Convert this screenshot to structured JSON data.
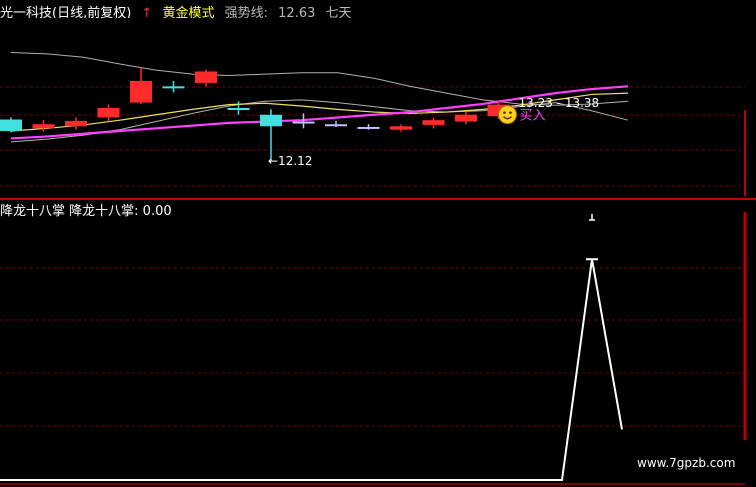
{
  "colors": {
    "background": "#000000",
    "grid": "#7a0000",
    "separator": "#c00000",
    "bull": "#ff2a2a",
    "bear": "#44e0e0",
    "ma_main": "#ff40ff",
    "ma_yellow": "#f0e060",
    "ma_grey": "#b0b0b0",
    "text_white": "#ffffff",
    "text_grey": "#b8b8b8",
    "text_yellow": "#ffff40"
  },
  "header": {
    "security": "光一科技(日线,前复权)",
    "arrow_icon": "↑",
    "indicator": "黄金模式",
    "strength_label": "强势线:",
    "strength_value": "12.63",
    "trailing_text": "七天"
  },
  "sub_header": {
    "name": "降龙十八掌",
    "value_label": "降龙十八掌: 0.00"
  },
  "annotations": {
    "low_price": "←12.12",
    "price_range": "13.23 - 13.38",
    "buy_signal": "买入"
  },
  "watermark": "www.7gpzb.com",
  "chart_data": [
    {
      "type": "candlestick",
      "panel": "main",
      "ylim": [
        11.6,
        14.2
      ],
      "candles": [
        {
          "o": 12.73,
          "c": 12.56,
          "h": 12.76,
          "l": 12.54
        },
        {
          "o": 12.6,
          "c": 12.66,
          "h": 12.72,
          "l": 12.55
        },
        {
          "o": 12.63,
          "c": 12.71,
          "h": 12.76,
          "l": 12.58
        },
        {
          "o": 12.76,
          "c": 12.9,
          "h": 12.95,
          "l": 12.7
        },
        {
          "o": 12.98,
          "c": 13.3,
          "h": 13.5,
          "l": 12.96
        },
        {
          "o": 13.22,
          "c": 13.22,
          "h": 13.3,
          "l": 13.13
        },
        {
          "o": 13.27,
          "c": 13.44,
          "h": 13.47,
          "l": 13.22
        },
        {
          "o": 12.9,
          "c": 12.9,
          "h": 13.0,
          "l": 12.8
        },
        {
          "o": 12.8,
          "c": 12.63,
          "h": 12.88,
          "l": 12.12
        },
        {
          "o": 12.7,
          "c": 12.7,
          "h": 12.82,
          "l": 12.6
        },
        {
          "o": 12.66,
          "c": 12.66,
          "h": 12.71,
          "l": 12.62
        },
        {
          "o": 12.62,
          "c": 12.62,
          "h": 12.66,
          "l": 12.58
        },
        {
          "o": 12.58,
          "c": 12.63,
          "h": 12.66,
          "l": 12.55
        },
        {
          "o": 12.65,
          "c": 12.72,
          "h": 12.76,
          "l": 12.6
        },
        {
          "o": 12.7,
          "c": 12.8,
          "h": 12.85,
          "l": 12.66
        },
        {
          "o": 12.78,
          "c": 12.95,
          "h": 13.0,
          "l": 12.74
        }
      ],
      "ma_main": [
        12.45,
        12.48,
        12.52,
        12.56,
        12.6,
        12.64,
        12.68,
        12.7,
        12.72,
        12.76,
        12.8,
        12.84,
        12.9,
        12.96,
        13.04,
        13.12,
        13.18,
        13.22
      ],
      "ma_yellow": [
        12.56,
        12.6,
        12.65,
        12.72,
        12.8,
        12.88,
        12.95,
        12.97,
        12.93,
        12.88,
        12.84,
        12.82,
        12.84,
        12.88,
        12.94,
        13.02,
        13.1,
        13.12
      ],
      "ma_grey_upper": [
        13.72,
        13.7,
        13.65,
        13.55,
        13.46,
        13.4,
        13.38,
        13.4,
        13.42,
        13.42,
        13.34,
        13.22,
        13.12,
        13.02,
        12.96,
        12.94,
        12.96,
        13.0
      ],
      "ma_grey_lower": [
        12.4,
        12.44,
        12.5,
        12.58,
        12.7,
        12.82,
        12.93,
        13.0,
        13.02,
        12.98,
        12.92,
        12.86,
        12.84,
        12.86,
        12.92,
        12.98,
        12.86,
        12.72
      ]
    },
    {
      "type": "line",
      "panel": "sub",
      "title": "降龙十八掌",
      "ylim": [
        0,
        100
      ],
      "x": [
        0,
        1,
        2,
        3,
        4,
        5,
        6,
        7,
        8,
        9,
        10,
        11,
        12,
        13,
        14,
        15,
        16,
        17
      ],
      "values": [
        0,
        0,
        0,
        0,
        0,
        0,
        0,
        0,
        0,
        0,
        0,
        0,
        0,
        0,
        0,
        0,
        83,
        19
      ],
      "top_marker": 100
    }
  ]
}
